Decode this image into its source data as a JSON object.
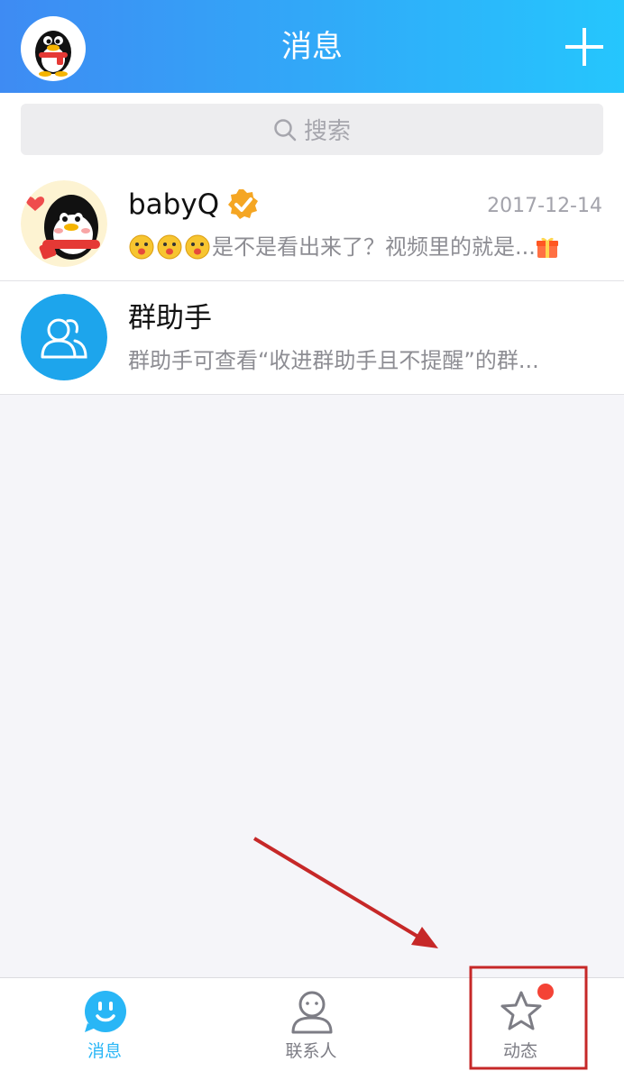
{
  "header": {
    "title": "消息"
  },
  "search": {
    "placeholder": "搜索"
  },
  "conversations": [
    {
      "name": "babyQ",
      "time": "2017-12-14",
      "preview": "是不是看出来了？视频里的就是...",
      "verified": true
    },
    {
      "name": "群助手",
      "time": "",
      "preview": "群助手可查看“收进群助手且不提醒”的群..."
    }
  ],
  "tabs": [
    {
      "label": "消息",
      "active": true
    },
    {
      "label": "联系人",
      "active": false
    },
    {
      "label": "动态",
      "active": false,
      "badge": true
    }
  ],
  "colors": {
    "header_start": "#3e8bf3",
    "header_end": "#25c6fd",
    "active_tab": "#29b6f6",
    "inactive_tab": "#7d7d85",
    "badge": "#f44336",
    "annotation": "#c62828"
  }
}
